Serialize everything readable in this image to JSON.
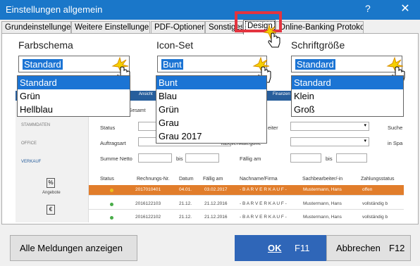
{
  "window": {
    "title": "Einstellungen allgemein",
    "help_label": "?",
    "close_glyph": "✕"
  },
  "tabs": [
    {
      "label": "Grundeinstellungen"
    },
    {
      "label": "Weitere Einstellungen"
    },
    {
      "label": "PDF-Optionen"
    },
    {
      "label": "Sonstiges"
    },
    {
      "label": "Design"
    },
    {
      "label": "Online-Banking Protokolle"
    }
  ],
  "design": {
    "color_scheme": {
      "label": "Farbschema",
      "value": "Standard",
      "options": [
        "Standard",
        "Grün",
        "Hellblau"
      ],
      "selected_index": 0
    },
    "icon_set": {
      "label": "Icon-Set",
      "value": "Bunt",
      "options": [
        "Bunt",
        "Blau",
        "Grün",
        "Grau",
        "Grau 2017"
      ],
      "selected_index": 0
    },
    "font_size": {
      "label": "Schriftgröße",
      "value": "Standard",
      "options": [
        "Standard",
        "Klein",
        "Groß"
      ],
      "selected_index": 0
    }
  },
  "preview": {
    "topbar": [
      "Ansicht",
      "Finanzen"
    ],
    "subtitle": "en (Gesamt",
    "sidebar": [
      "STAMMDATEN",
      "OFFICE",
      "VERKAUF"
    ],
    "sidebar_icon_label": "Angebote",
    "filters": {
      "status": "Status",
      "auftragsart": "Auftragsart",
      "summe_netto": "Summe Netto",
      "bis": "bis",
      "sachbearbeiter": "eiter",
      "tabellenkategorie": "Tabellenkategorie",
      "faellig_am": "Fällig am",
      "suche": "Suche",
      "in_spalte": "in Spa"
    },
    "columns": [
      "Status",
      "Rechnungs-Nr.",
      "Datum",
      "Fällig am",
      "Nachname/Firma",
      "Sachbearbeiter/-in",
      "Zahlungsstatus"
    ],
    "rows": [
      {
        "nr": "2017010401",
        "datum": "04.01.",
        "faellig": "03.02.2017",
        "name": "- B A R V E R K A U F -",
        "sb": "Mustermann, Hans",
        "status": "offen",
        "dot": "#f2c200",
        "highlight": true
      },
      {
        "nr": "2016122103",
        "datum": "21.12.",
        "faellig": "21.12.2016",
        "name": "- B A R V E R K A U F -",
        "sb": "Mustermann, Hans",
        "status": "vollständig b",
        "dot": "#3cb13c",
        "highlight": false
      },
      {
        "nr": "2016122102",
        "datum": "21.12.",
        "faellig": "21.12.2016",
        "name": "- B A R V E R K A U F -",
        "sb": "Mustermann, Hans",
        "status": "vollständig b",
        "dot": "#3cb13c",
        "highlight": false
      }
    ]
  },
  "footer": {
    "show_messages": "Alle Meldungen anzeigen",
    "ok_label": "OK",
    "ok_key": "F11",
    "cancel_label": "Abbrechen",
    "cancel_key": "F12"
  },
  "colors": {
    "titlebar": "#1a77c9",
    "selection": "#1b74d4",
    "highlight_box": "#e3343f",
    "primary_button": "#2f66b8"
  }
}
